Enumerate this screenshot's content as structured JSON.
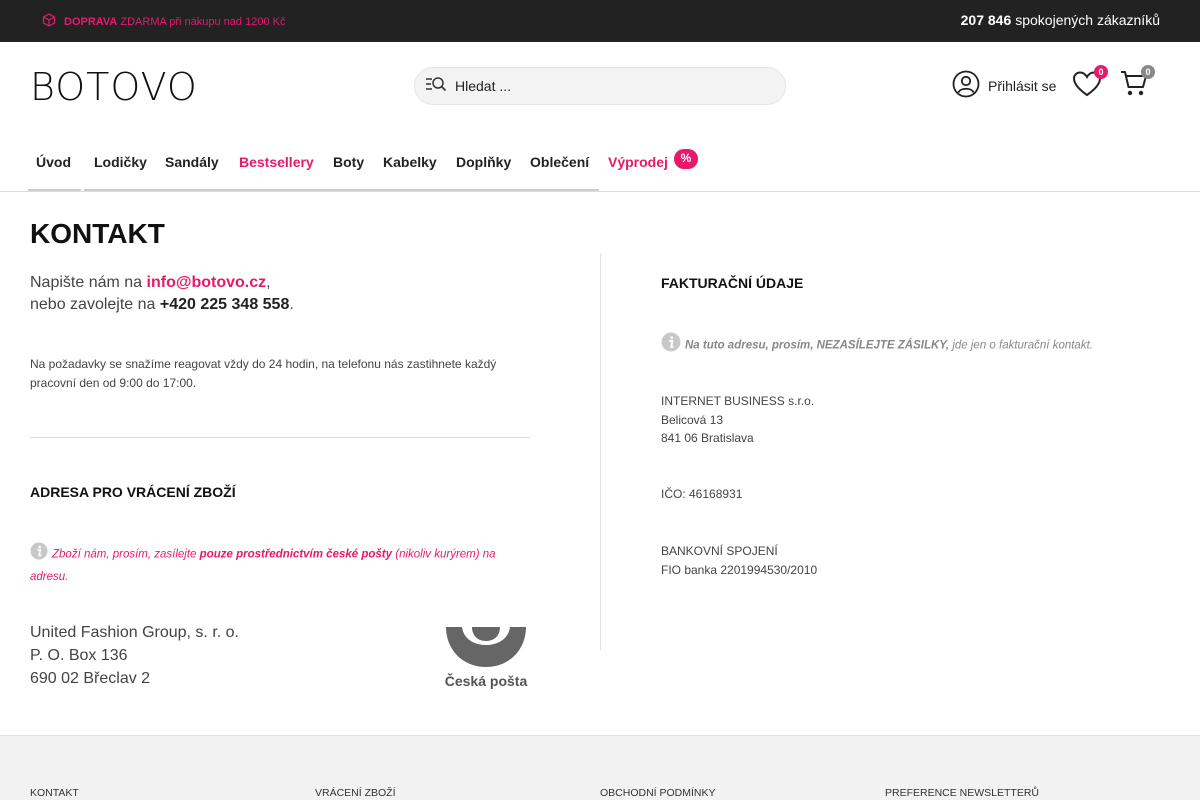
{
  "topbar": {
    "shipping_strong": "DOPRAVA",
    "shipping_rest": "ZDARMA při nákupu nad 1200 Kč",
    "customers_count": "207 846",
    "customers_label": "spokojených zákazníků"
  },
  "header": {
    "logo": "BOTOVO",
    "search_placeholder": "Hledat ...",
    "login_label": "Přihlásit se",
    "wishlist_count": "0",
    "cart_count": "0"
  },
  "nav": {
    "items": [
      "Úvod",
      "Lodičky",
      "Sandály",
      "Bestsellery",
      "Boty",
      "Kabelky",
      "Doplňky",
      "Oblečení",
      "Výprodej"
    ],
    "sale_badge": "%"
  },
  "main": {
    "title": "KONTAKT",
    "write_prefix": "Napište nám na",
    "email": "info@botovo.cz",
    "call_prefix": "nebo zavolejte na",
    "phone": "+420 225 348 558",
    "hours_text": "Na požadavky se snažíme reagovat vždy do 24 hodin, na telefonu nás zastihnete každý pracovní den od 9:00 do 17:00.",
    "return_title": "ADRESA PRO VRÁCENÍ ZBOŽÍ",
    "return_note_a": "Zboží nám, prosím, zasílejte",
    "return_note_b": "pouze prostřednictvím české pošty",
    "return_note_c": "(nikoliv kurýrem) na adresu.",
    "return_address": [
      "United Fashion Group, s. r. o.",
      "P. O. Box 136",
      "690 02 Břeclav 2"
    ],
    "posta_logo_text": "Česká pošta"
  },
  "billing": {
    "title": "FAKTURAČNÍ ÚDAJE",
    "note_a": "Na tuto adresu, prosím, NEZASÍLEJTE ZÁSILKY,",
    "note_b": "jde jen o fakturační kontakt.",
    "company": [
      "INTERNET BUSINESS s.r.o.",
      "Belicová 13",
      "841 06 Bratislava"
    ],
    "ico": "IČO: 46168931",
    "bank_title": "BANKOVNÍ SPOJENÍ",
    "bank_account": "FIO banka 2201994530/2010"
  },
  "footer": {
    "links": [
      "KONTAKT",
      "VRÁCENÍ ZBOŽÍ",
      "OBCHODNÍ PODMÍNKY",
      "PREFERENCE NEWSLETTERŮ"
    ]
  },
  "colors": {
    "accent": "#e8196b",
    "topbar": "#222222",
    "footer": "#f2f2f2"
  }
}
